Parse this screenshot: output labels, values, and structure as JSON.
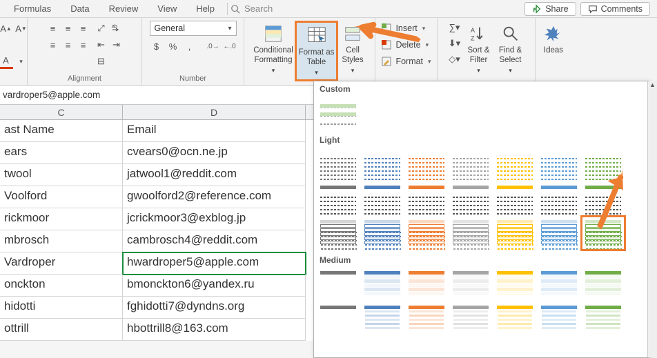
{
  "menu": {
    "formulas": "Formulas",
    "data": "Data",
    "review": "Review",
    "view": "View",
    "help": "Help",
    "search": "Search"
  },
  "actions": {
    "share": "Share",
    "comments": "Comments"
  },
  "number": {
    "group": "Number",
    "format": "General"
  },
  "alignment": {
    "group": "Alignment"
  },
  "styles": {
    "conditional_formatting": "Conditional Formatting",
    "format_as_table": "Format as Table",
    "cell_styles": "Cell Styles"
  },
  "cells": {
    "insert": "Insert",
    "delete": "Delete",
    "format": "Format"
  },
  "editing": {
    "sort_filter": "Sort & Filter",
    "find_select": "Find & Select"
  },
  "ideas": {
    "label": "Ideas"
  },
  "formula_bar": "vardroper5@apple.com",
  "columns": {
    "c": "C",
    "d": "D"
  },
  "rows": [
    {
      "c": "ast Name",
      "d": "Email"
    },
    {
      "c": "ears",
      "d": "cvears0@ocn.ne.jp"
    },
    {
      "c": "twool",
      "d": "jatwool1@reddit.com"
    },
    {
      "c": "Voolford",
      "d": "gwoolford2@reference.com"
    },
    {
      "c": "rickmoor",
      "d": "jcrickmoor3@exblog.jp"
    },
    {
      "c": "mbrosch",
      "d": "cambrosch4@reddit.com"
    },
    {
      "c": "Vardroper",
      "d": "hwardroper5@apple.com"
    },
    {
      "c": "onckton",
      "d": "bmonckton6@yandex.ru"
    },
    {
      "c": "hidotti",
      "d": "fghidotti7@dyndns.org"
    },
    {
      "c": "ottrill",
      "d": "hbottrill8@163.com"
    }
  ],
  "active_row": 6,
  "dropdown": {
    "custom": "Custom",
    "light": "Light",
    "medium": "Medium",
    "palette": [
      "#777",
      "#4f81bd",
      "#ed7d31",
      "#a5a5a5",
      "#ffc000",
      "#5b9bd5",
      "#70ad47"
    ]
  }
}
